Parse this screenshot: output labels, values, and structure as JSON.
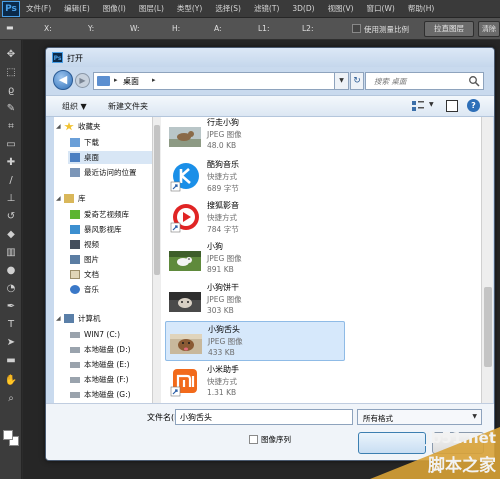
{
  "app": {
    "logo": "Ps",
    "menus": [
      "文件(F)",
      "编辑(E)",
      "图像(I)",
      "图层(L)",
      "类型(Y)",
      "选择(S)",
      "滤镜(T)",
      "3D(D)",
      "视图(V)",
      "窗口(W)",
      "帮助(H)"
    ]
  },
  "options_bar": {
    "labels": [
      "X:",
      "Y:",
      "W:",
      "H:",
      "A:",
      "L1:",
      "L2:"
    ],
    "checkbox_label": "使用测量比例",
    "button_label": "拉直图层",
    "button2_label": "清除"
  },
  "toolbar": {
    "tools": [
      "move-tool",
      "marquee-tool",
      "lasso-tool",
      "quick-select-tool",
      "crop-tool",
      "ruler-tool",
      "healing-tool",
      "brush-tool",
      "stamp-tool",
      "history-brush-tool",
      "eraser-tool",
      "gradient-tool",
      "blur-tool",
      "dodge-tool",
      "pen-tool",
      "type-tool",
      "path-select-tool",
      "shape-tool",
      "hand-tool",
      "zoom-tool"
    ]
  },
  "dialog": {
    "title": "打开",
    "address": {
      "current": "桌面",
      "search_placeholder": "搜索 桌面"
    },
    "commands": {
      "organize": "组织 ▼",
      "new_folder": "新建文件夹"
    },
    "nav": {
      "favorites_header": "收藏夹",
      "favorites": [
        "下载",
        "桌面",
        "最近访问的位置"
      ],
      "libraries_header": "库",
      "libraries": [
        "爱奇艺视频库",
        "暴风影视库",
        "视频",
        "图片",
        "文档",
        "音乐"
      ],
      "computer_header": "计算机",
      "drives": [
        "WIN7 (C:)",
        "本地磁盘 (D:)",
        "本地磁盘 (E:)",
        "本地磁盘 (F:)",
        "本地磁盘 (G:)"
      ]
    },
    "files": [
      {
        "name": "行走小狗",
        "type": "JPEG 图像",
        "size": "48.0 KB",
        "icon": "walking-dog-thumbnail"
      },
      {
        "name": "酷狗音乐",
        "type": "快捷方式",
        "size": "689 字节",
        "icon": "kugou-icon"
      },
      {
        "name": "搜狐影音",
        "type": "快捷方式",
        "size": "784 字节",
        "icon": "sohu-video-icon"
      },
      {
        "name": "小狗",
        "type": "JPEG 图像",
        "size": "891 KB",
        "icon": "puppy-thumbnail"
      },
      {
        "name": "小狗饼干",
        "type": "JPEG 图像",
        "size": "303 KB",
        "icon": "dog-biscuit-thumbnail"
      },
      {
        "name": "小狗舌头",
        "type": "JPEG 图像",
        "size": "433 KB",
        "icon": "dog-tongue-thumbnail"
      },
      {
        "name": "小米助手",
        "type": "快捷方式",
        "size": "1.31 KB",
        "icon": "xiaomi-icon"
      }
    ],
    "selected_file": "小狗舌头",
    "filename_label": "文件名(N):",
    "filename_value": "小狗舌头",
    "filetype_value": "所有格式",
    "image_sequence_label": "图像序列"
  },
  "watermark": {
    "url": "jb51.net",
    "brand": "脚本之家"
  },
  "colors": {
    "selection": "#d6e8fb",
    "dialog_frame": "#c9daee",
    "ps_chrome": "#3a3a3a"
  }
}
